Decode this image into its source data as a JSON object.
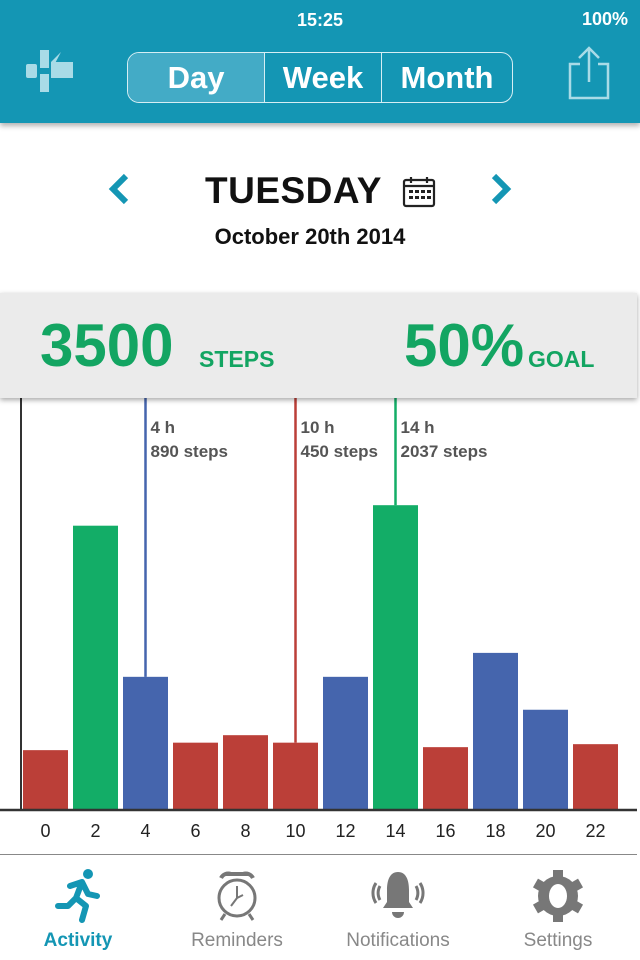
{
  "status_bar": {
    "time": "15:25",
    "battery": "100%"
  },
  "header": {
    "segments": [
      {
        "label": "Day",
        "selected": true
      },
      {
        "label": "Week",
        "selected": false
      },
      {
        "label": "Month",
        "selected": false
      }
    ],
    "brand_color": "#1496b4"
  },
  "date_nav": {
    "day": "TUESDAY",
    "date": "October 20th 2014"
  },
  "summary": {
    "steps": "3500",
    "steps_unit": "STEPS",
    "goal": "50%",
    "goal_unit": "GOAL",
    "accent": "#13a562"
  },
  "chart_data": {
    "type": "bar",
    "categories": [
      "0",
      "2",
      "4",
      "6",
      "8",
      "10",
      "12",
      "14",
      "16",
      "18",
      "20",
      "22"
    ],
    "values": [
      400,
      1900,
      890,
      450,
      500,
      450,
      890,
      2037,
      420,
      1050,
      670,
      440
    ],
    "bar_colors": [
      "#bb3f38",
      "#13ad67",
      "#4565ad",
      "#bb3f38",
      "#bb3f38",
      "#bb3f38",
      "#4565ad",
      "#13ad67",
      "#bb3f38",
      "#4565ad",
      "#4565ad",
      "#bb3f38"
    ],
    "ylim": [
      0,
      2740
    ],
    "annotations": [
      {
        "index": 2,
        "hour": "4 h",
        "steps": "890 steps",
        "color": "#4565ad"
      },
      {
        "index": 5,
        "hour": "10 h",
        "steps": "450 steps",
        "color": "#bb3f38"
      },
      {
        "index": 7,
        "hour": "14 h",
        "steps": "2037 steps",
        "color": "#13ad67"
      }
    ]
  },
  "tabs": [
    {
      "label": "Activity",
      "icon": "running-icon",
      "active": true
    },
    {
      "label": "Reminders",
      "icon": "alarm-clock-icon",
      "active": false
    },
    {
      "label": "Notifications",
      "icon": "bell-icon",
      "active": false
    },
    {
      "label": "Settings",
      "icon": "gear-icon",
      "active": false
    }
  ]
}
